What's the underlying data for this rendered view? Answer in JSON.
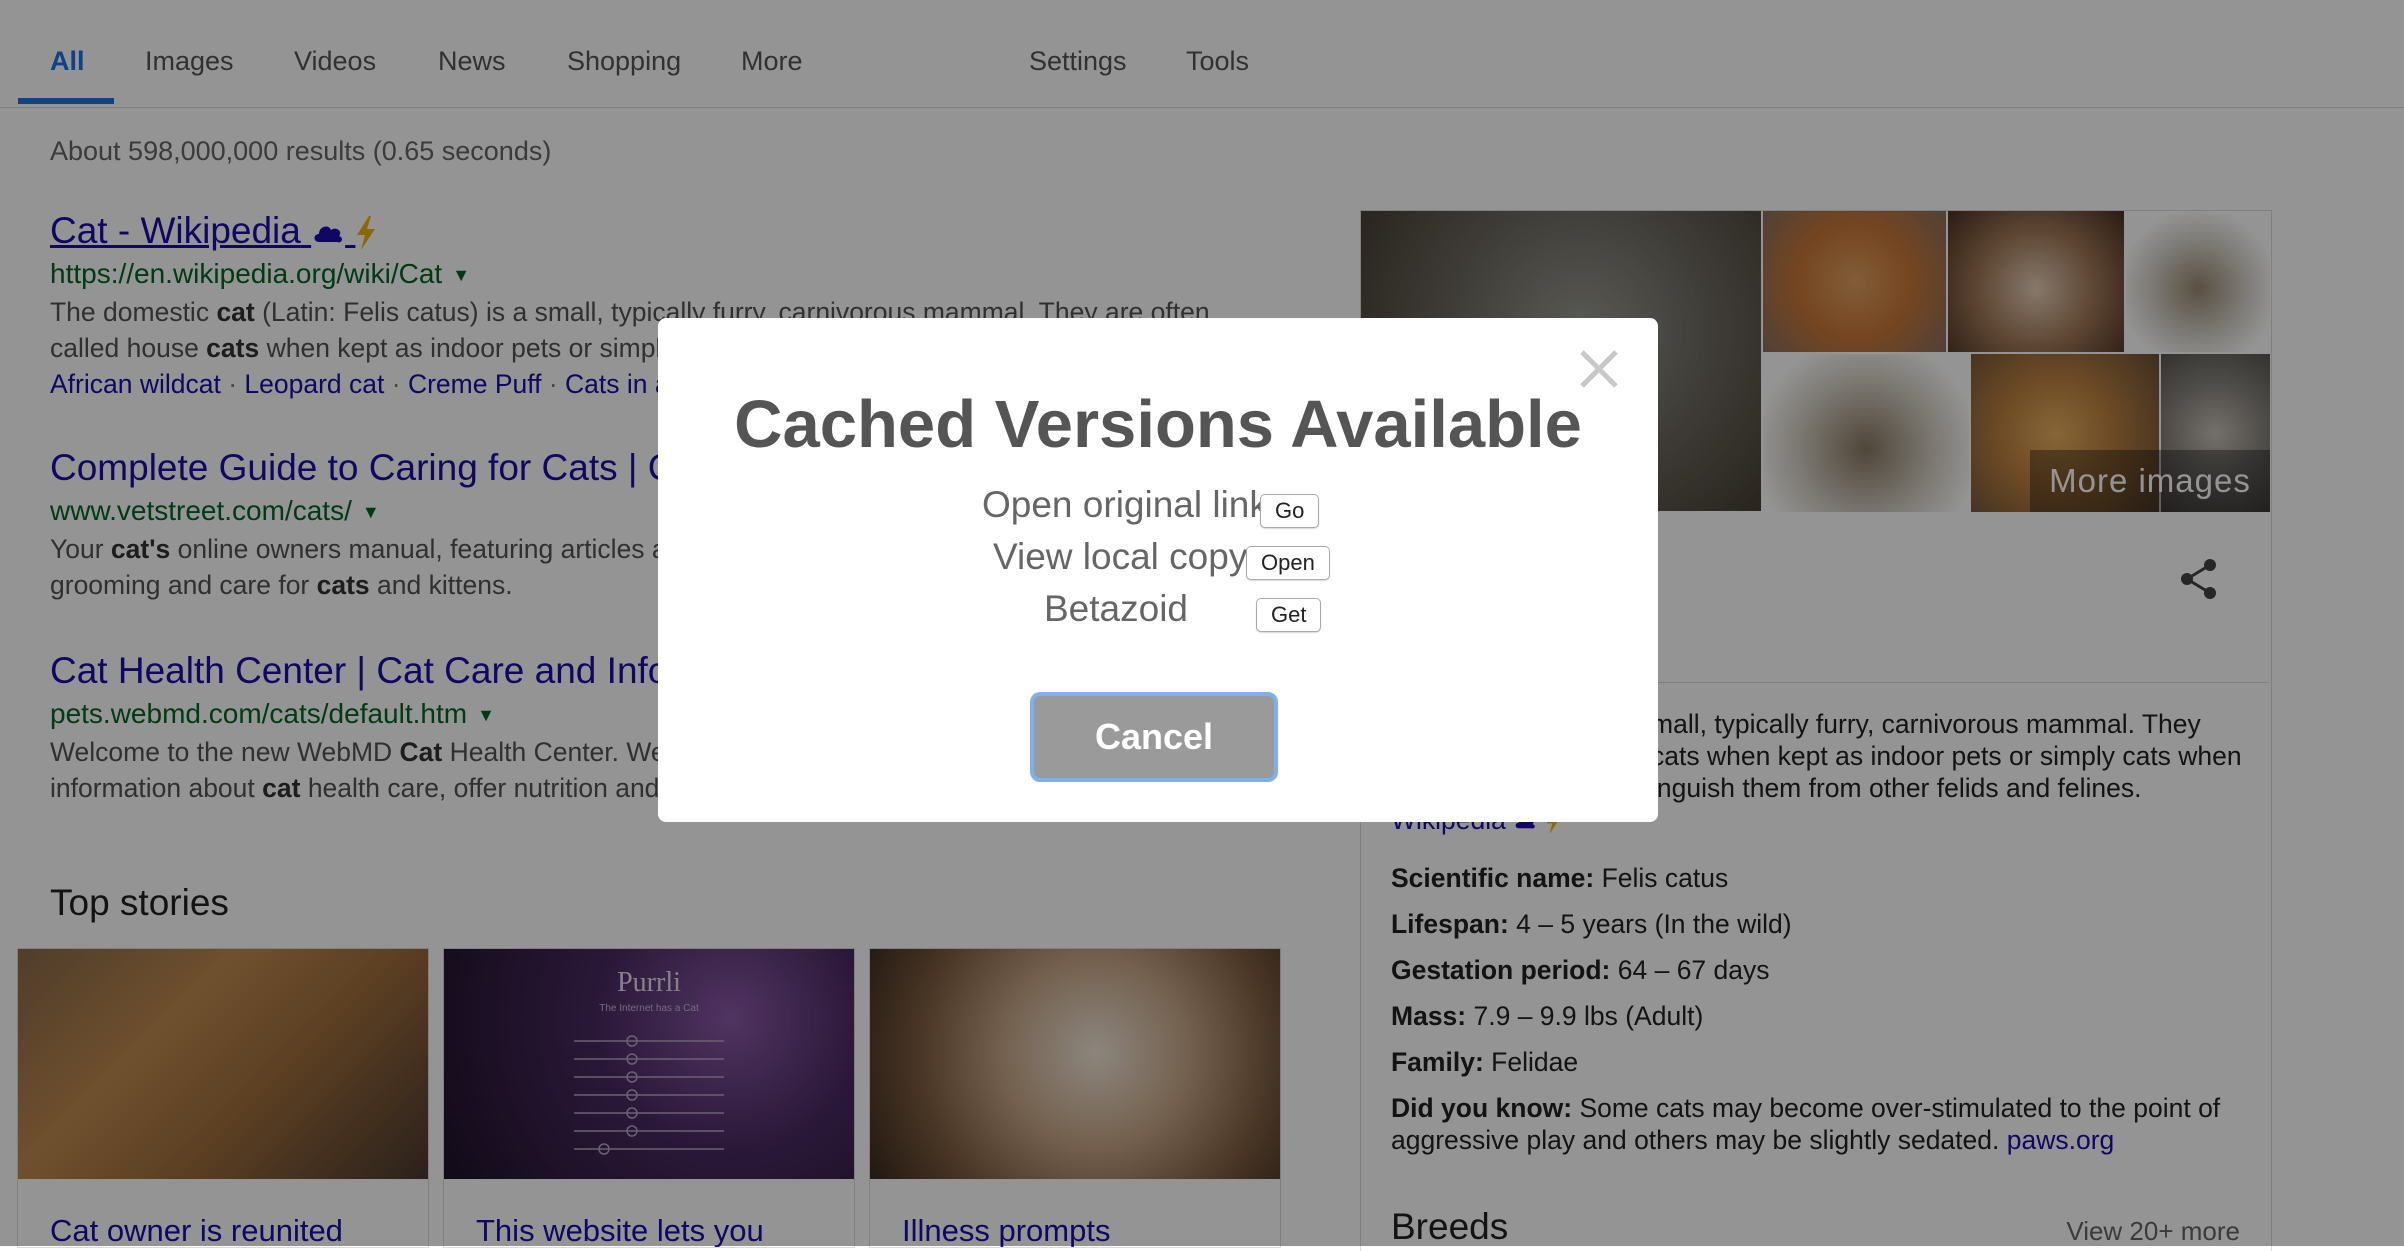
{
  "nav": {
    "tabs": [
      "All",
      "Images",
      "Videos",
      "News",
      "Shopping",
      "More"
    ],
    "tools": [
      "Settings",
      "Tools"
    ]
  },
  "stats": "About 598,000,000 results (0.65 seconds)",
  "results": [
    {
      "title": "Cat - Wikipedia",
      "url": "https://en.wikipedia.org/wiki/Cat",
      "snippet_parts": [
        "The domestic ",
        "cat",
        " (Latin: Felis catus) is a small, typically furry, carnivorous mammal. They are often",
        "called house ",
        "cats",
        " when kept as indoor pets or simply"
      ],
      "links": [
        "African wildcat",
        "Leopard cat",
        "Creme Puff",
        "Cats in ar"
      ]
    },
    {
      "title": "Complete Guide to Caring for Cats | Ca",
      "url": "www.vetstreet.com/cats/",
      "snippet_parts": [
        "Your ",
        "cat's",
        " online owners manual, featuring articles ab",
        "grooming and care for ",
        "cats",
        " and kittens."
      ]
    },
    {
      "title": "Cat Health Center | Cat Care and Inforn",
      "url": "pets.webmd.com/cats/default.htm",
      "snippet_parts": [
        "Welcome to the new WebMD ",
        "Cat",
        " Health Center. Webl",
        "information about ",
        "cat",
        " health care, offer nutrition and"
      ]
    }
  ],
  "top_stories": {
    "heading": "Top stories",
    "items": [
      {
        "title": "Cat owner is reunited"
      },
      {
        "title": "This website lets you",
        "thumb_brand": "Purrli",
        "thumb_tagline": "The Internet has a Cat"
      },
      {
        "title": "Illness prompts"
      }
    ]
  },
  "knowledge_panel": {
    "more_images": "More images",
    "description_lines": [
      "mall, typically furry, carnivorous mammal. They",
      "cats when kept as indoor pets or simply cats when",
      "inguish them from other felids and felines."
    ],
    "source": "Wikipedia",
    "facts": [
      {
        "label": "Scientific name:",
        "value": " Felis catus"
      },
      {
        "label": "Lifespan:",
        "value": " 4 – 5 years (In the wild)"
      },
      {
        "label": "Gestation period:",
        "value": " 64 – 67 days"
      },
      {
        "label": "Mass:",
        "value": " 7.9 – 9.9 lbs (Adult)"
      },
      {
        "label": "Family:",
        "value": " Felidae"
      }
    ],
    "did_you_know": {
      "label": "Did you know:",
      "text": " Some cats may become over-stimulated to the point of aggressive play and others may be slightly sedated. ",
      "link": "paws.org"
    },
    "breeds_heading": "Breeds",
    "breeds_more": "View 20+ more"
  },
  "modal": {
    "title": "Cached Versions Available",
    "options": [
      {
        "label": "Open original link",
        "button": "Go"
      },
      {
        "label": "View local copy",
        "button": "Open"
      },
      {
        "label": "Betazoid",
        "button": "Get"
      }
    ],
    "cancel": "Cancel"
  },
  "colors": {
    "accent": "#1a73e8",
    "link": "#1a0dab",
    "url_green": "#006621",
    "overlay": "rgba(0,0,0,0.42)"
  }
}
